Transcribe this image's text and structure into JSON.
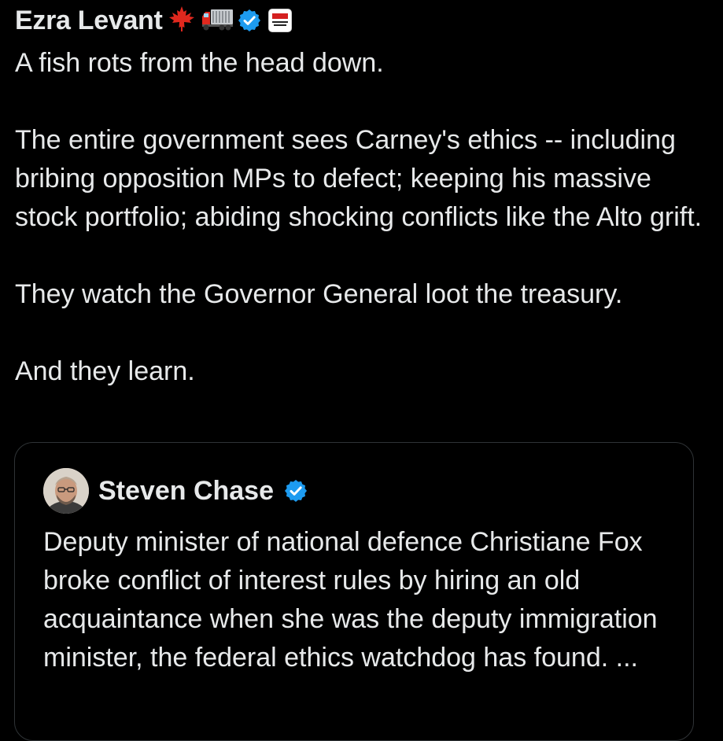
{
  "post": {
    "author_name": "Ezra Levant",
    "emoji_maple": "🍁",
    "emoji_truck": "🚛",
    "verified_icon": "verified-badge-icon",
    "affiliate_badge": "rebel-news-badge-icon",
    "paragraphs": [
      "A fish rots from the head down.",
      "The entire government sees Carney's ethics -- including bribing opposition MPs to defect; keeping his massive stock portfolio; abiding shocking conflicts like the Alto grift.",
      "They watch the Governor General loot the treasury.",
      "And they learn."
    ]
  },
  "quoted_post": {
    "author_name": "Steven Chase",
    "verified_icon": "verified-badge-icon",
    "text": "Deputy minister of national defence Christiane Fox broke conflict of interest rules by hiring an old acquaintance when she was the deputy immigration minister, the federal ethics watchdog has found. ..."
  },
  "colors": {
    "background": "#000000",
    "text": "#e7e9ea",
    "verified_blue": "#1d9bf0",
    "card_border": "#2f3336"
  }
}
